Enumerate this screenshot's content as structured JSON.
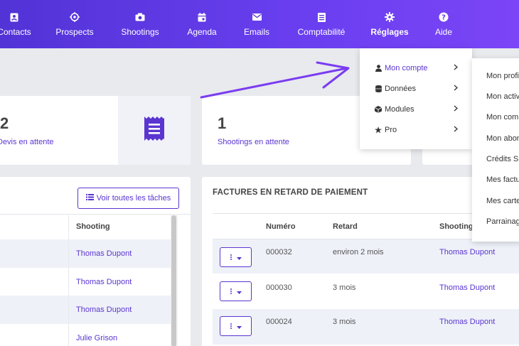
{
  "nav": {
    "items": [
      {
        "label": "Contacts",
        "icon": "contacts-icon"
      },
      {
        "label": "Prospects",
        "icon": "target-icon"
      },
      {
        "label": "Shootings",
        "icon": "camera-icon"
      },
      {
        "label": "Agenda",
        "icon": "calendar-icon"
      },
      {
        "label": "Emails",
        "icon": "envelope-icon"
      },
      {
        "label": "Comptabilité",
        "icon": "ledger-icon"
      },
      {
        "label": "Réglages",
        "icon": "gear-icon"
      },
      {
        "label": "Aide",
        "icon": "help-icon"
      }
    ],
    "active": "Réglages"
  },
  "stats": {
    "devis": {
      "count": "2",
      "label": "Devis en attente"
    },
    "shootings": {
      "count": "1",
      "label": "Shootings en attente"
    }
  },
  "tasks": {
    "button_label": "Voir toutes les tâches",
    "column_shooting": "Shooting",
    "rows": [
      "Thomas Dupont",
      "Thomas Dupont",
      "Thomas Dupont",
      "Julie Grison"
    ]
  },
  "invoices": {
    "title": "FACTURES EN RETARD DE PAIEMENT",
    "columns": {
      "numero": "Numéro",
      "retard": "Retard",
      "shooting": "Shooting"
    },
    "rows": [
      {
        "numero": "000032",
        "retard": "environ 2 mois",
        "shooting": "Thomas Dupont"
      },
      {
        "numero": "000030",
        "retard": "3 mois",
        "shooting": "Thomas Dupont"
      },
      {
        "numero": "000024",
        "retard": "3 mois",
        "shooting": "Thomas Dupont"
      }
    ]
  },
  "settings_menu": {
    "items": [
      {
        "label": "Mon compte",
        "icon": "user-icon"
      },
      {
        "label": "Données",
        "icon": "database-icon"
      },
      {
        "label": "Modules",
        "icon": "cube-icon"
      },
      {
        "label": "Pro",
        "icon": "star-icon"
      }
    ]
  },
  "account_submenu": {
    "items": [
      "Mon profi",
      "Mon activ",
      "Mon com",
      "Mon abon",
      "Crédits S",
      "Mes factu",
      "Mes carte",
      "Parrainag"
    ]
  },
  "colors": {
    "accent": "#5a35d0",
    "nav_start": "#5233d6",
    "nav_end": "#7b45f6",
    "annotation": "#7a3cf0"
  }
}
